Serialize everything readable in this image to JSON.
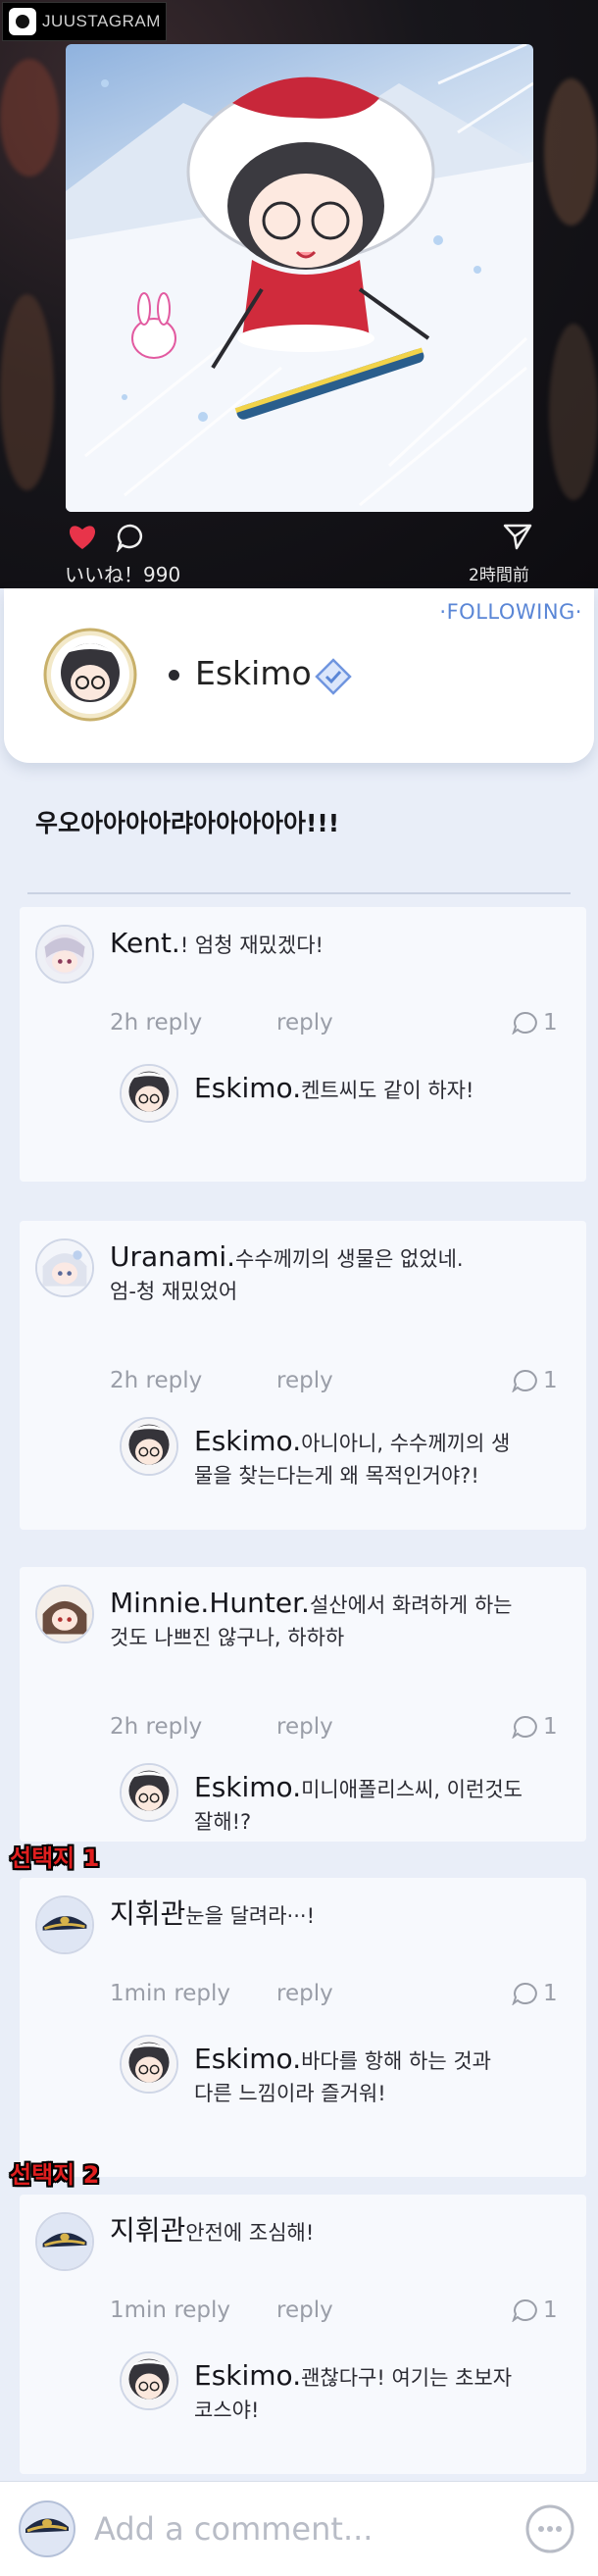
{
  "app": {
    "brand": "JUUSTAGRAM",
    "logo_icon": "camera-icon"
  },
  "post": {
    "likes_text": "いいね！990",
    "time_text": "2時間前",
    "author": "Eskimo",
    "follow_label": "·FOLLOWING·",
    "caption": "우오아아아아랴아아아아아!!!"
  },
  "comments": [
    {
      "user": "Kent.",
      "text": "! 엄청 재밌겠다!",
      "lines": [
        "! 엄청 재밌겠다!"
      ],
      "time": "2h reply",
      "reply_label": "reply",
      "count": "1",
      "reply": {
        "user": "Eskimo.",
        "lines": [
          "켄트씨도 같이 하자!"
        ]
      }
    },
    {
      "user": "Uranami.",
      "lines": [
        "수수께끼의 생물은 없었네.",
        "엄-청 재밌었어"
      ],
      "time": "2h reply",
      "reply_label": "reply",
      "count": "1",
      "reply": {
        "user": "Eskimo.",
        "lines": [
          "아니아니, 수수께끼의 생",
          "물을 찾는다는게 왜 목적인거야?!"
        ]
      }
    },
    {
      "user": "Minnie.Hunter.",
      "lines": [
        "설산에서 화려하게 하는",
        "것도 나쁘진 않구나, 하하하"
      ],
      "time": "2h reply",
      "reply_label": "reply",
      "count": "1",
      "reply": {
        "user": "Eskimo.",
        "lines": [
          "미니애폴리스씨, 이런것도",
          "잘해!?"
        ]
      }
    },
    {
      "choice": "선택지 1",
      "user": "지휘관",
      "lines": [
        "눈을 달려라···!"
      ],
      "time": "1min reply",
      "reply_label": "reply",
      "count": "1",
      "reply": {
        "user": "Eskimo.",
        "lines": [
          "바다를 항해 하는 것과",
          "다른 느낌이라 즐거워!"
        ]
      }
    },
    {
      "choice": "선택지 2",
      "user": "지휘관",
      "lines": [
        "안전에 조심해!"
      ],
      "time": "1min reply",
      "reply_label": "reply",
      "count": "1",
      "reply": {
        "user": "Eskimo.",
        "lines": [
          "괜찮다구! 여기는 초보자",
          "코스야!"
        ]
      }
    }
  ],
  "input": {
    "placeholder": "Add a comment..."
  },
  "icons": {
    "like": "heart-icon",
    "comment": "comment-icon",
    "share": "send-icon",
    "verified": "verified-badge-icon",
    "reply_count": "comment-count-icon",
    "emoji": "emoji-icon"
  },
  "colors": {
    "accent": "#5a86d6",
    "like": "#e8344a",
    "choice_label": "#e01f1f"
  }
}
